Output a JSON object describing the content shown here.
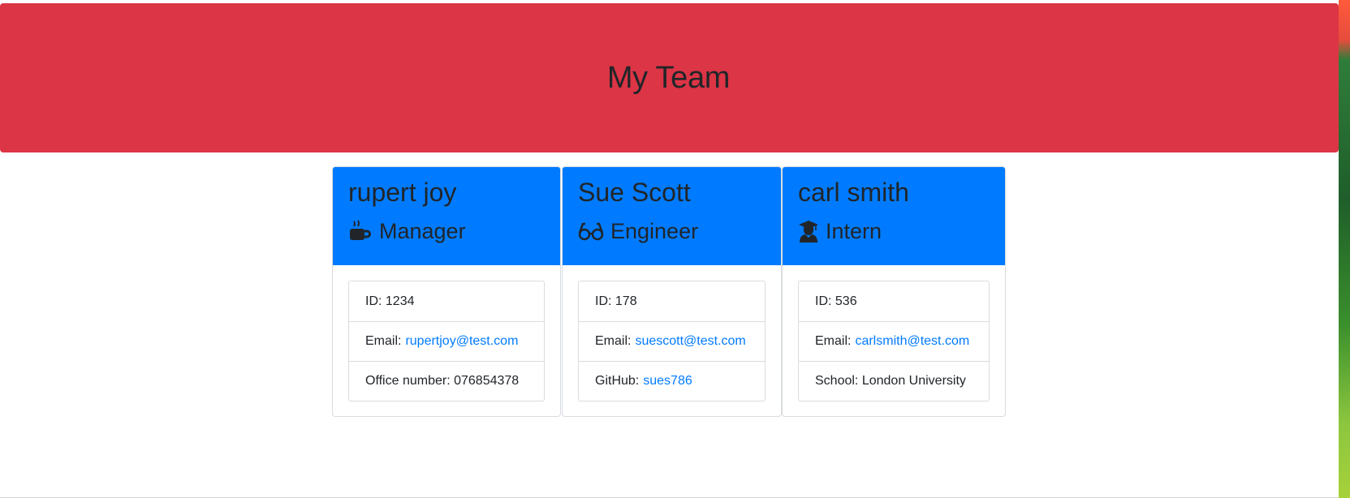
{
  "header": {
    "title": "My Team"
  },
  "team": [
    {
      "name": "rupert joy",
      "role": "Manager",
      "icon": "coffee-icon",
      "id_label": "ID:",
      "id_value": "1234",
      "email_label": "Email:",
      "email": "rupertjoy@test.com",
      "extra_label": "Office number:",
      "extra_value": "076854378"
    },
    {
      "name": "Sue Scott",
      "role": "Engineer",
      "icon": "glasses-icon",
      "id_label": "ID:",
      "id_value": "178",
      "email_label": "Email:",
      "email": "suescott@test.com",
      "extra_label": "GitHub:",
      "extra_value": "sues786"
    },
    {
      "name": "carl smith",
      "role": "Intern",
      "icon": "graduate-icon",
      "id_label": "ID:",
      "id_value": "536",
      "email_label": "Email:",
      "email": "carlsmith@test.com",
      "extra_label": "School:",
      "extra_value": "London University"
    }
  ],
  "colors": {
    "header_bg": "#dc3545",
    "card_head_bg": "#007bff",
    "link": "#007bff"
  }
}
